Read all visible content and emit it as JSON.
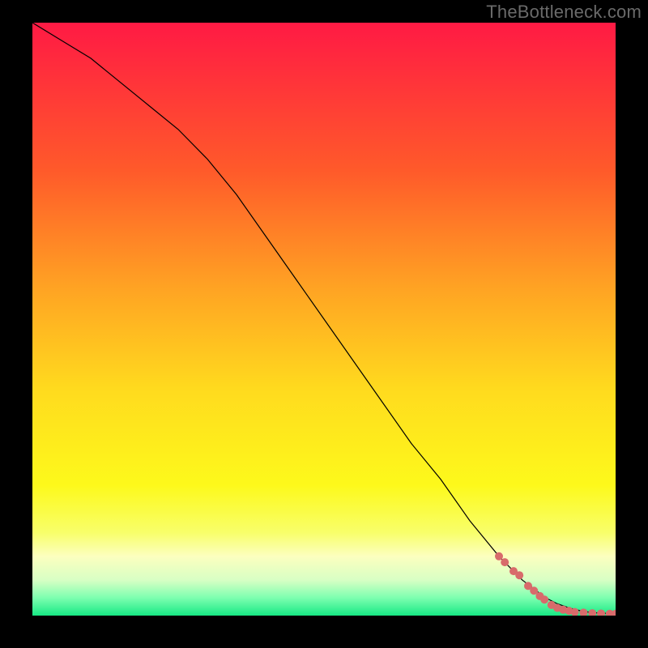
{
  "watermark": "TheBottleneck.com",
  "chart_data": {
    "type": "line",
    "title": "",
    "xlabel": "",
    "ylabel": "",
    "xlim": [
      0,
      100
    ],
    "ylim": [
      0,
      100
    ],
    "legend": false,
    "grid": false,
    "background_gradient_stops": [
      {
        "offset": 0,
        "color": "#ff1a44"
      },
      {
        "offset": 25,
        "color": "#ff5a2a"
      },
      {
        "offset": 45,
        "color": "#ffa423"
      },
      {
        "offset": 62,
        "color": "#ffdb1e"
      },
      {
        "offset": 78,
        "color": "#fdf91b"
      },
      {
        "offset": 86,
        "color": "#f8ff6a"
      },
      {
        "offset": 90,
        "color": "#fcffbf"
      },
      {
        "offset": 94,
        "color": "#d8ffc4"
      },
      {
        "offset": 97,
        "color": "#7dffb0"
      },
      {
        "offset": 100,
        "color": "#17e884"
      }
    ],
    "series": [
      {
        "name": "curve",
        "stroke": "#000000",
        "stroke_width": 1.2,
        "x": [
          0,
          5,
          10,
          15,
          20,
          25,
          30,
          35,
          40,
          45,
          50,
          55,
          60,
          65,
          70,
          75,
          80,
          82,
          84,
          86,
          88,
          90,
          92,
          94,
          96,
          98,
          100
        ],
        "y": [
          100,
          97,
          94,
          90,
          86,
          82,
          77,
          71,
          64,
          57,
          50,
          43,
          36,
          29,
          23,
          16,
          10,
          8,
          6,
          4.5,
          3,
          2,
          1.3,
          0.8,
          0.5,
          0.4,
          0.3
        ]
      }
    ],
    "markers": {
      "name": "highlight-points",
      "color": "#d86b6b",
      "radius": 5,
      "x": [
        80,
        81,
        82.5,
        83.5,
        85,
        86,
        87,
        87.8,
        89,
        90,
        91,
        92,
        93,
        94.5,
        96,
        97.5,
        99,
        100
      ],
      "y": [
        10,
        9,
        7.5,
        6.8,
        5,
        4.2,
        3.3,
        2.7,
        1.8,
        1.3,
        1.0,
        0.8,
        0.6,
        0.5,
        0.4,
        0.35,
        0.3,
        0.3
      ]
    }
  }
}
